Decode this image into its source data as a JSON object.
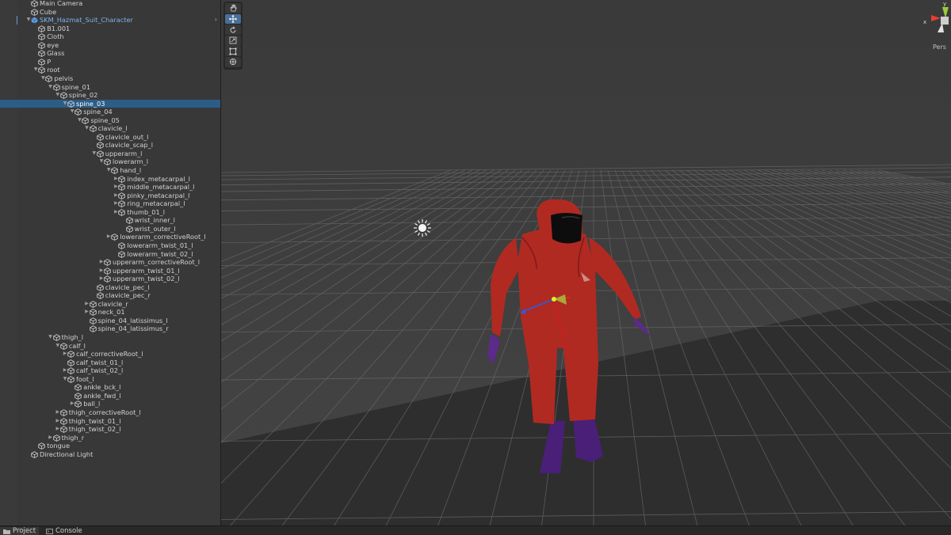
{
  "hierarchy": {
    "items": [
      {
        "label": "Main Camera",
        "depth": 0,
        "arrow": "",
        "kind": "go"
      },
      {
        "label": "Cube",
        "depth": 0,
        "arrow": "",
        "kind": "go"
      },
      {
        "label": "SKM_Hazmat_Suit_Character",
        "depth": 0,
        "arrow": "down",
        "kind": "prefab"
      },
      {
        "label": "B1.001",
        "depth": 1,
        "arrow": "",
        "kind": "go"
      },
      {
        "label": "Cloth",
        "depth": 1,
        "arrow": "",
        "kind": "go"
      },
      {
        "label": "eye",
        "depth": 1,
        "arrow": "",
        "kind": "go"
      },
      {
        "label": "Glass",
        "depth": 1,
        "arrow": "",
        "kind": "go"
      },
      {
        "label": "P",
        "depth": 1,
        "arrow": "",
        "kind": "go"
      },
      {
        "label": "root",
        "depth": 1,
        "arrow": "down",
        "kind": "go"
      },
      {
        "label": "pelvis",
        "depth": 2,
        "arrow": "down",
        "kind": "go"
      },
      {
        "label": "spine_01",
        "depth": 3,
        "arrow": "down",
        "kind": "go"
      },
      {
        "label": "spine_02",
        "depth": 4,
        "arrow": "down",
        "kind": "go"
      },
      {
        "label": "spine_03",
        "depth": 5,
        "arrow": "down",
        "kind": "go",
        "selected": true
      },
      {
        "label": "spine_04",
        "depth": 6,
        "arrow": "down",
        "kind": "go"
      },
      {
        "label": "spine_05",
        "depth": 7,
        "arrow": "down",
        "kind": "go"
      },
      {
        "label": "clavicle_l",
        "depth": 8,
        "arrow": "down",
        "kind": "go"
      },
      {
        "label": "clavicle_out_l",
        "depth": 9,
        "arrow": "",
        "kind": "go"
      },
      {
        "label": "clavicle_scap_l",
        "depth": 9,
        "arrow": "",
        "kind": "go"
      },
      {
        "label": "upperarm_l",
        "depth": 9,
        "arrow": "down",
        "kind": "go"
      },
      {
        "label": "lowerarm_l",
        "depth": 10,
        "arrow": "down",
        "kind": "go"
      },
      {
        "label": "hand_l",
        "depth": 11,
        "arrow": "down",
        "kind": "go"
      },
      {
        "label": "index_metacarpal_l",
        "depth": 12,
        "arrow": "right",
        "kind": "go"
      },
      {
        "label": "middle_metacarpal_l",
        "depth": 12,
        "arrow": "right",
        "kind": "go"
      },
      {
        "label": "pinky_metacarpal_l",
        "depth": 12,
        "arrow": "right",
        "kind": "go"
      },
      {
        "label": "ring_metacarpal_l",
        "depth": 12,
        "arrow": "right",
        "kind": "go"
      },
      {
        "label": "thumb_01_l",
        "depth": 12,
        "arrow": "right",
        "kind": "go"
      },
      {
        "label": "wrist_inner_l",
        "depth": 13,
        "arrow": "",
        "kind": "go"
      },
      {
        "label": "wrist_outer_l",
        "depth": 13,
        "arrow": "",
        "kind": "go"
      },
      {
        "label": "lowerarm_correctiveRoot_l",
        "depth": 11,
        "arrow": "right",
        "kind": "go"
      },
      {
        "label": "lowerarm_twist_01_l",
        "depth": 12,
        "arrow": "",
        "kind": "go"
      },
      {
        "label": "lowerarm_twist_02_l",
        "depth": 12,
        "arrow": "",
        "kind": "go"
      },
      {
        "label": "upperarm_correctiveRoot_l",
        "depth": 10,
        "arrow": "right",
        "kind": "go"
      },
      {
        "label": "upperarm_twist_01_l",
        "depth": 10,
        "arrow": "right",
        "kind": "go"
      },
      {
        "label": "upperarm_twist_02_l",
        "depth": 10,
        "arrow": "right",
        "kind": "go"
      },
      {
        "label": "clavicle_pec_l",
        "depth": 9,
        "arrow": "",
        "kind": "go"
      },
      {
        "label": "clavicle_pec_r",
        "depth": 9,
        "arrow": "",
        "kind": "go"
      },
      {
        "label": "clavicle_r",
        "depth": 8,
        "arrow": "right",
        "kind": "go"
      },
      {
        "label": "neck_01",
        "depth": 8,
        "arrow": "right",
        "kind": "go"
      },
      {
        "label": "spine_04_latissimus_l",
        "depth": 8,
        "arrow": "",
        "kind": "go"
      },
      {
        "label": "spine_04_latissimus_r",
        "depth": 8,
        "arrow": "",
        "kind": "go"
      },
      {
        "label": "thigh_l",
        "depth": 3,
        "arrow": "down",
        "kind": "go"
      },
      {
        "label": "calf_l",
        "depth": 4,
        "arrow": "down",
        "kind": "go"
      },
      {
        "label": "calf_correctiveRoot_l",
        "depth": 5,
        "arrow": "right",
        "kind": "go"
      },
      {
        "label": "calf_twist_01_l",
        "depth": 5,
        "arrow": "",
        "kind": "go"
      },
      {
        "label": "calf_twist_02_l",
        "depth": 5,
        "arrow": "right",
        "kind": "go"
      },
      {
        "label": "foot_l",
        "depth": 5,
        "arrow": "down",
        "kind": "go"
      },
      {
        "label": "ankle_bck_l",
        "depth": 6,
        "arrow": "",
        "kind": "go"
      },
      {
        "label": "ankle_fwd_l",
        "depth": 6,
        "arrow": "",
        "kind": "go"
      },
      {
        "label": "ball_l",
        "depth": 6,
        "arrow": "right",
        "kind": "go"
      },
      {
        "label": "thigh_correctiveRoot_l",
        "depth": 4,
        "arrow": "right",
        "kind": "go"
      },
      {
        "label": "thigh_twist_01_l",
        "depth": 4,
        "arrow": "right",
        "kind": "go"
      },
      {
        "label": "thigh_twist_02_l",
        "depth": 4,
        "arrow": "right",
        "kind": "go"
      },
      {
        "label": "thigh_r",
        "depth": 3,
        "arrow": "right",
        "kind": "go"
      },
      {
        "label": "tongue",
        "depth": 1,
        "arrow": "",
        "kind": "go"
      },
      {
        "label": "Directional Light",
        "depth": 0,
        "arrow": "",
        "kind": "go"
      }
    ]
  },
  "scene": {
    "persp_label": "Pers",
    "gizmo_axis_labels": {
      "x": "x",
      "y": "y"
    },
    "tools": [
      "hand-tool",
      "move-tool",
      "rotate-tool",
      "scale-tool",
      "rect-tool",
      "transform-tool"
    ],
    "active_tool": "move-tool",
    "colors": {
      "suit": "#b02a22",
      "gloves": "#5b2a8a",
      "boots": "#4a1f78",
      "selection": "#2c5d87",
      "prefab_text": "#7fb3ec"
    }
  },
  "bottom_tabs": [
    {
      "label": "Project",
      "icon": "folder-icon",
      "active": true
    },
    {
      "label": "Console",
      "icon": "console-icon",
      "active": false
    }
  ]
}
